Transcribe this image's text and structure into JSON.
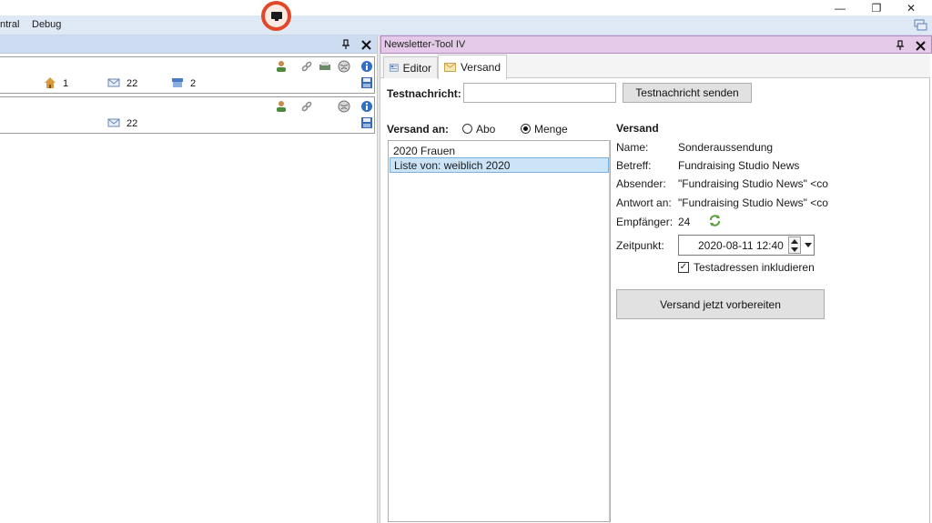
{
  "window": {
    "min_glyph": "—",
    "max_glyph": "❐",
    "close_glyph": "✕"
  },
  "menubar": {
    "items": [
      "ntral",
      "Debug"
    ]
  },
  "left_pane": {
    "card1": {
      "count_home": "1",
      "count_mail": "22",
      "count_box": "2"
    },
    "card2": {
      "count_mail": "22"
    }
  },
  "right_pane": {
    "title": "Newsletter-Tool IV",
    "tabs": {
      "editor": "Editor",
      "versand": "Versand"
    },
    "test": {
      "label": "Testnachricht:",
      "value": "",
      "button": "Testnachricht senden"
    },
    "versand_an": {
      "label": "Versand an:",
      "abo": "Abo",
      "menge": "Menge",
      "selected": "Menge"
    },
    "list": [
      "2020 Frauen",
      "Liste von: weiblich 2020"
    ],
    "details": {
      "heading": "Versand",
      "name_label": "Name:",
      "name_value": "Sonderaussendung",
      "betreff_label": "Betreff:",
      "betreff_value": "Fundraising Studio News",
      "absender_label": "Absender:",
      "absender_value": "\"Fundraising Studio News\" <co",
      "antwort_label": "Antwort an:",
      "antwort_value": "\"Fundraising Studio News\" <co",
      "empfaenger_label": "Empfänger:",
      "empfaenger_value": "24",
      "zeitpunkt_label": "Zeitpunkt:",
      "zeitpunkt_value": "2020-08-11 12:40",
      "testadressen_label": "Testadressen inkludieren",
      "testadressen_checked": true,
      "prepare_button": "Versand jetzt vorbereiten"
    }
  },
  "colors": {
    "accent_record": "#e2472a",
    "left_header": "#cddcf1",
    "right_header": "#e4c9e8",
    "selection": "#cce4f7"
  }
}
